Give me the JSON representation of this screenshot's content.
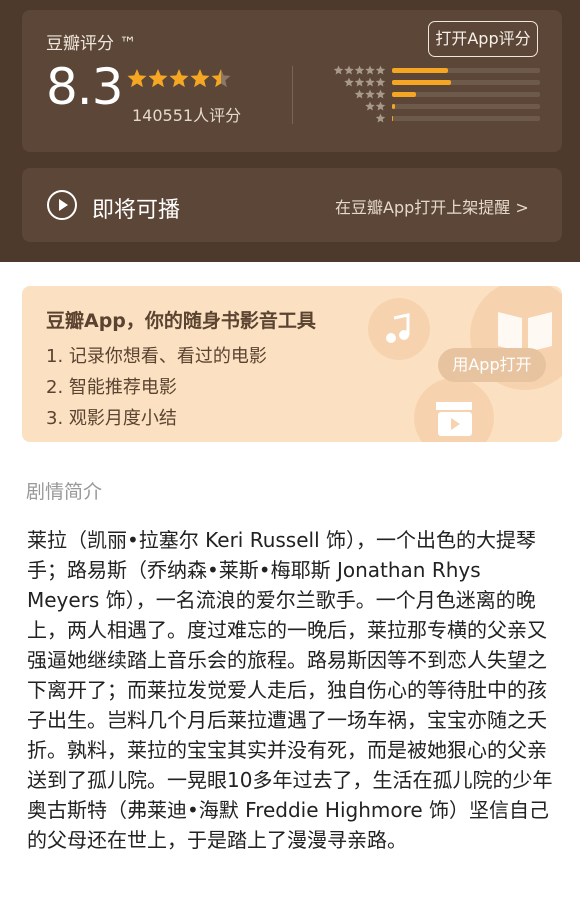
{
  "rating": {
    "title": "豆瓣评分 ™",
    "open_button": "打开App评分",
    "score": "8.3",
    "stars": 4.5,
    "count_text": "140551人评分",
    "distribution": [
      0.38,
      0.4,
      0.16,
      0.02,
      0.01
    ]
  },
  "playback": {
    "label": "即将可播",
    "remind_text": "在豆瓣App打开上架提醒 >"
  },
  "promo": {
    "title": "豆瓣App，你的随身书影音工具",
    "items": [
      "1. 记录你想看、看过的电影",
      "2. 智能推荐电影",
      "3. 观影月度小结"
    ],
    "button": "用App打开"
  },
  "synopsis": {
    "section_title": "剧情简介",
    "text": "莱拉（凯丽•拉塞尔 Keri Russell 饰），一个出色的大提琴手；路易斯（乔纳森•莱斯•梅耶斯 Jonathan Rhys Meyers 饰），一名流浪的爱尔兰歌手。一个月色迷离的晚上，两人相遇了。度过难忘的一晚后，莱拉那专横的父亲又强逼她继续踏上音乐会的旅程。路易斯因等不到恋人失望之下离开了；而莱拉发觉爱人走后，独自伤心的等待肚中的孩子出生。岂料几个月后莱拉遭遇了一场车祸，宝宝亦随之夭折。孰料，莱拉的宝宝其实并没有死，而是被她狠心的父亲送到了孤儿院。一晃眼10多年过去了，生活在孤儿院的少年奥古斯特（弗莱迪•海默 Freddie Highmore 饰）坚信自己的父母还在世上，于是踏上了漫漫寻亲路。"
  },
  "colors": {
    "header_bg": "#4d3a2d",
    "card_bg": "#5b4637",
    "star": "#f5a623",
    "promo_bg": "#fbe1c2"
  },
  "icons": {
    "rating_stars": "star-icon",
    "play": "play-circle-icon",
    "promo_decor": [
      "music-note-icon",
      "book-icon",
      "film-icon"
    ]
  }
}
